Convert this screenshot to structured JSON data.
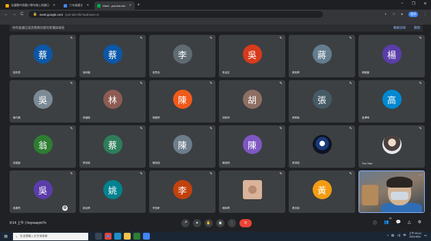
{
  "browser": {
    "tabs": [
      {
        "label": "花蓮縣中原國小學年線上授課日",
        "favicon_color": "#f9ab00",
        "active": false
      },
      {
        "label": "六年級國文",
        "favicon_color": "#4285f4",
        "active": false
      },
      {
        "label": "Meet - yxk-tukr-kfx",
        "favicon_color": "#00ac47",
        "active": true
      }
    ],
    "new_tab": "+",
    "window_controls": [
      "–",
      "❐",
      "✕"
    ],
    "url_host": "meet.google.com",
    "url_path": "/yxk-tukr-kfx?authuser=0",
    "right_pill": "暫停",
    "nav": [
      "←",
      "→",
      "C"
    ]
  },
  "meeting": {
    "info_text": "你的會議已成為需要同意的新聞與報名",
    "info_links": [
      "瞭解詳情",
      "關閉"
    ]
  },
  "participants": [
    {
      "name": "梁鈞賢",
      "avatar_text": "蔡",
      "avatar_color": "#0b57a8"
    },
    {
      "name": "吳昕穎",
      "avatar_text": "蔡",
      "avatar_color": "#0b57a8"
    },
    {
      "name": "張思含",
      "avatar_text": "李",
      "avatar_color": "#5f6b73"
    },
    {
      "name": "蔡孟宏",
      "avatar_text": "吳",
      "avatar_color": "#d63b1c"
    },
    {
      "name": "黃奕晴",
      "avatar_text": "蔣",
      "avatar_color": "#647d8e"
    },
    {
      "name": "楊雅媛",
      "avatar_text": "楊",
      "avatar_color": "#5b3daa"
    },
    {
      "name": "陳巧嫻",
      "avatar_text": "吳",
      "avatar_color": "#7b8a95"
    },
    {
      "name": "林國峰",
      "avatar_text": "林",
      "avatar_color": "#8d5b52"
    },
    {
      "name": "楊寶婷",
      "avatar_text": "陳",
      "avatar_color": "#f05a1a"
    },
    {
      "name": "胡祐明",
      "avatar_text": "胡",
      "avatar_color": "#8d6e63"
    },
    {
      "name": "張佩瑜",
      "avatar_text": "張",
      "avatar_color": "#455a64"
    },
    {
      "name": "高澤瑋",
      "avatar_text": "高",
      "avatar_color": "#0288d1"
    },
    {
      "name": "翁嘉諭",
      "avatar_text": "翁",
      "avatar_color": "#2e7d32"
    },
    {
      "name": "蔡柏瑜",
      "avatar_text": "蔡",
      "avatar_color": "#2e7d5a"
    },
    {
      "name": "陳宜瑄",
      "avatar_text": "陳",
      "avatar_color": "#6d7d8b"
    },
    {
      "name": "陳冠錡",
      "avatar_text": "陳",
      "avatar_color": "#7e57c2"
    },
    {
      "name": "張淳語",
      "avatar_text": "",
      "avatar_color": ""
    },
    {
      "name": "Tom Tsan",
      "avatar_text": "",
      "avatar_color": ""
    },
    {
      "name": "吳婕恩",
      "avatar_text": "吳",
      "avatar_color": "#5b3daa"
    },
    {
      "name": "姚品晴",
      "avatar_text": "姚",
      "avatar_color": "#00838f"
    },
    {
      "name": "李宜軒",
      "avatar_text": "李",
      "avatar_color": "#c2410c"
    },
    {
      "name": "楊詠晴",
      "avatar_text": "",
      "avatar_color": ""
    },
    {
      "name": "黃苡瑄",
      "avatar_text": "黃",
      "avatar_color": "#f39c12"
    },
    {
      "name": "",
      "avatar_text": "",
      "avatar_color": ""
    }
  ],
  "toolbar": {
    "time_and_code": "9:14 上午 | hoysuaym7n",
    "controls": [
      "🎤",
      "⏺",
      "✋",
      "▣",
      "⋮"
    ],
    "end_call_icon": "✆",
    "right_icons": [
      "ⓘ",
      "👥",
      "💬",
      "△",
      "⚙"
    ],
    "people_count": "24"
  },
  "taskbar": {
    "search_placeholder": "在這裡輸入文字來搜尋",
    "tray_lang": "中",
    "tray_time": "上午 09:14",
    "tray_date": "2021/5/31"
  }
}
